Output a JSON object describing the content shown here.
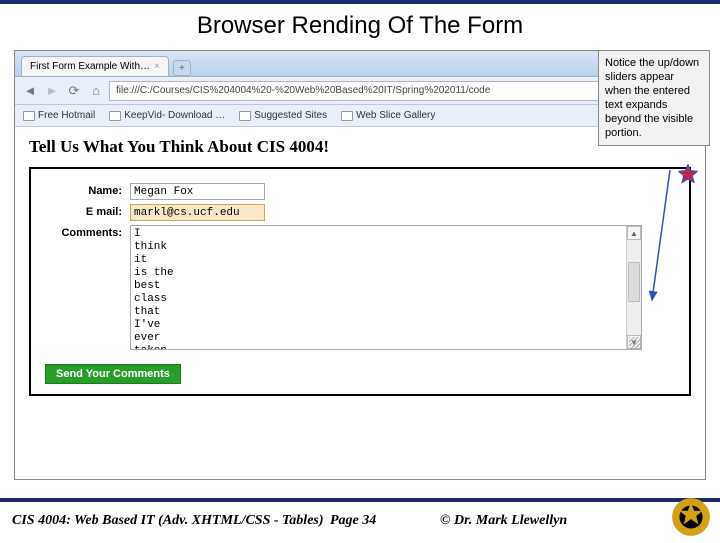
{
  "slide_title": "Browser Rending Of The Form",
  "browser": {
    "tab_title": "First Form Example With…",
    "url": "file:///C:/Courses/CIS%204004%20-%20Web%20Based%20IT/Spring%202011/code",
    "bookmarks": [
      "Free Hotmail",
      "KeepVid- Download …",
      "Suggested Sites",
      "Web Slice Gallery"
    ]
  },
  "page": {
    "heading": "Tell Us What You Think About CIS 4004!",
    "labels": {
      "name": "Name:",
      "email": "E mail:",
      "comments": "Comments:"
    },
    "name_value": "Megan Fox",
    "email_value": "markl@cs.ucf.edu",
    "comments_value": "I\nthink\nit\nis the\nbest\nclass\nthat\nI've\never\ntaken",
    "submit_label": "Send Your Comments"
  },
  "callout_text": "Notice the up/down sliders appear when the entered text expands beyond the visible portion.",
  "footer": {
    "course": "CIS 4004: Web Based IT (Adv. XHTML/CSS - Tables)",
    "page": "Page 34",
    "copyright": "© Dr. Mark Llewellyn"
  }
}
